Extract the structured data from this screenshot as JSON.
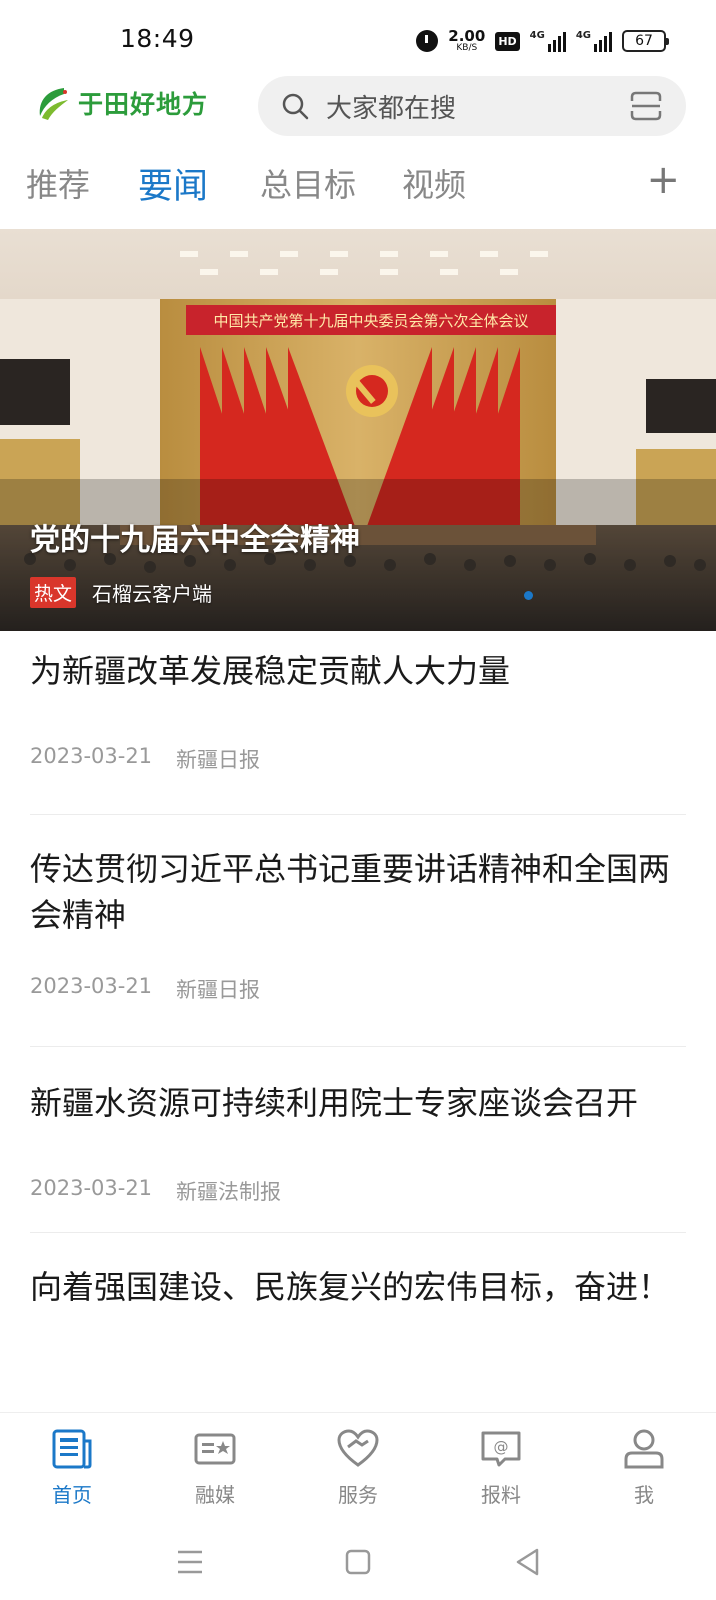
{
  "status_bar": {
    "time": "18:49",
    "net_speed_value": "2.00",
    "net_speed_unit": "KB/S",
    "hd_label": "HD",
    "signal1_label": "4G",
    "signal2_label": "4G",
    "battery_level": "67"
  },
  "header": {
    "logo_text": "于田好地方",
    "search_placeholder": "大家都在搜"
  },
  "tabs": [
    {
      "label": "推荐",
      "active": false
    },
    {
      "label": "要闻",
      "active": true
    },
    {
      "label": "总目标",
      "active": false
    },
    {
      "label": "视频",
      "active": false
    }
  ],
  "tab_add_label": "+",
  "banner": {
    "title": "党的十九届六中全会精神",
    "badge": "热文",
    "source": "石榴云客户端",
    "sign_text": "中国共产党第十九届中央委员会第六次全体会议"
  },
  "news": [
    {
      "title": "为新疆改革发展稳定贡献人大力量",
      "date": "2023-03-21",
      "source": "新疆日报"
    },
    {
      "title": "传达贯彻习近平总书记重要讲话精神和全国两会精神",
      "date": "2023-03-21",
      "source": "新疆日报"
    },
    {
      "title": "新疆水资源可持续利用院士专家座谈会召开",
      "date": "2023-03-21",
      "source": "新疆法制报"
    },
    {
      "title": "向着强国建设、民族复兴的宏伟目标，奋进！",
      "date": "",
      "source": ""
    }
  ],
  "bottom_nav": [
    {
      "label": "首页",
      "icon": "home-news-icon",
      "active": true
    },
    {
      "label": "融媒",
      "icon": "media-card-icon",
      "active": false
    },
    {
      "label": "服务",
      "icon": "heart-service-icon",
      "active": false
    },
    {
      "label": "报料",
      "icon": "report-chat-icon",
      "active": false
    },
    {
      "label": "我",
      "icon": "user-profile-icon",
      "active": false
    }
  ],
  "colors": {
    "accent": "#1b78c8",
    "logo_green": "#2c9c3b",
    "hot_red": "#d9362b"
  }
}
